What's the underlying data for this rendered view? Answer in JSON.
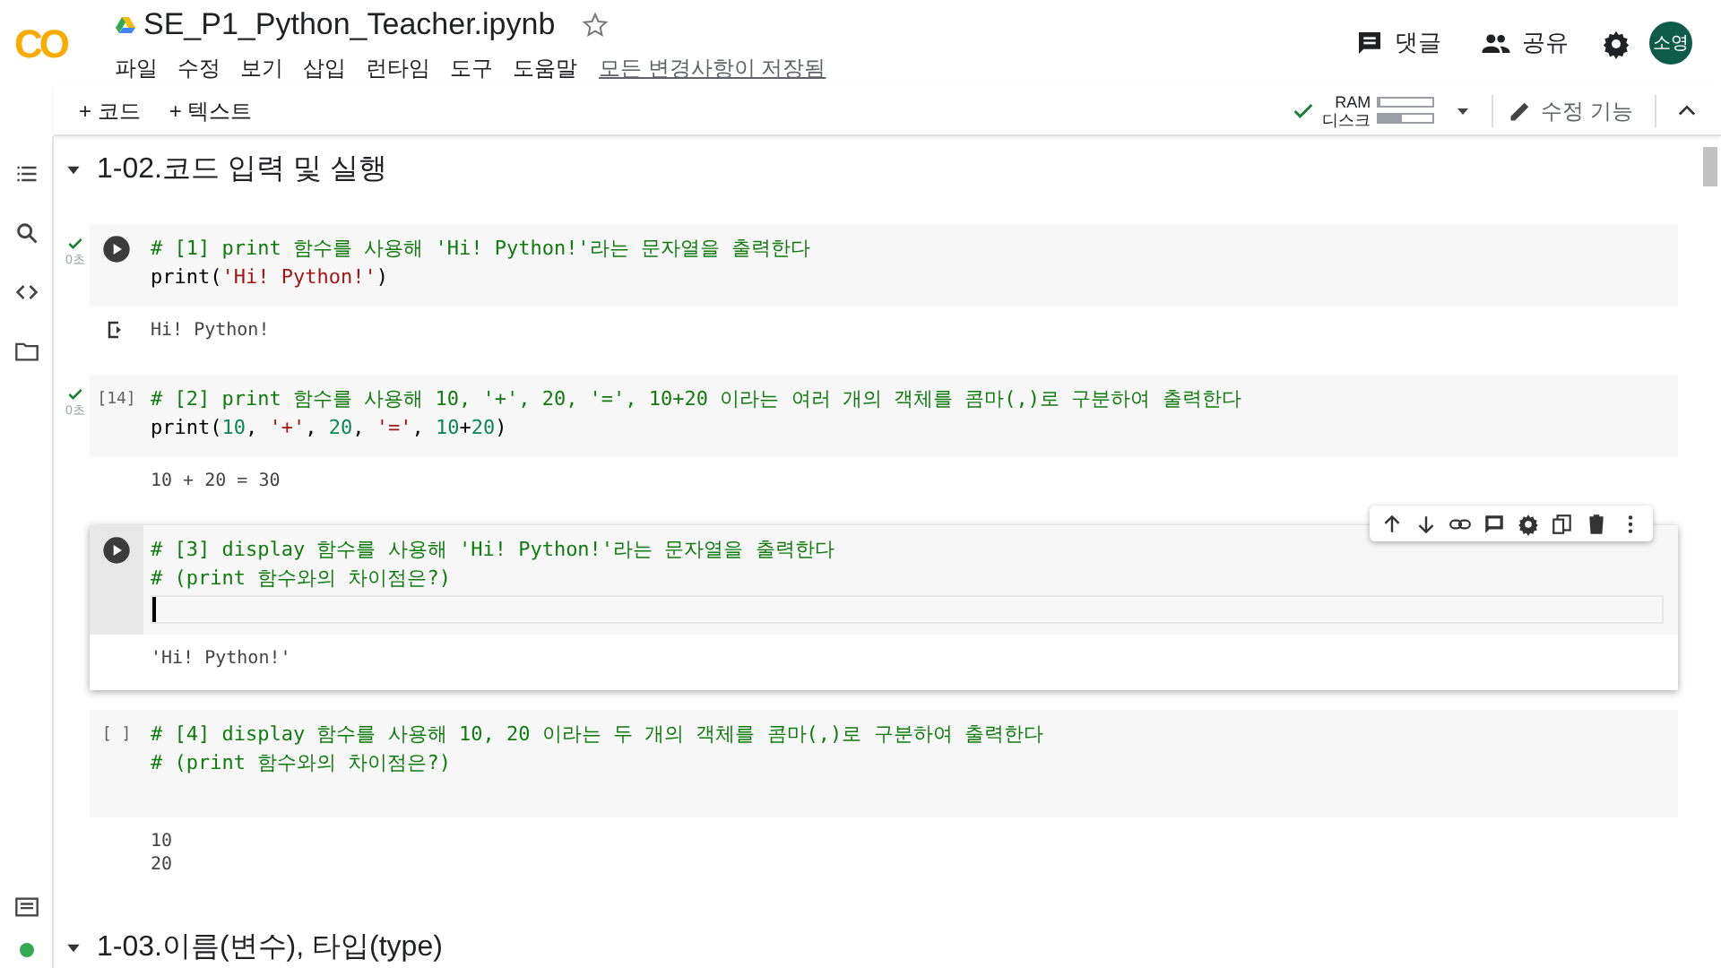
{
  "app": {
    "logo": "CO",
    "title": "SE_P1_Python_Teacher.ipynb",
    "starred": false,
    "menu": [
      "파일",
      "수정",
      "보기",
      "삽입",
      "런타임",
      "도구",
      "도움말"
    ],
    "save_status": "모든 변경사항이 저장됨",
    "comment_button": "댓글",
    "share_button": "공유",
    "avatar": "소영"
  },
  "toolbar": {
    "add_code": "+ 코드",
    "add_text": "+ 텍스트",
    "connected": true,
    "ram": {
      "label": "RAM",
      "level": 0.05
    },
    "disk": {
      "label": "디스크",
      "level": 0.45
    },
    "edit_mode": "수정 기능"
  },
  "sections": [
    {
      "title": "1-02.코드 입력 및 실행",
      "expanded": true,
      "cells": [
        {
          "kind": "run_button",
          "done": true,
          "run_time": "0초",
          "focused": false,
          "lines": [
            [
              {
                "kind": "comment",
                "text": "# [1] print 함수를 사용해 'Hi! Python!'라는 문자열을 출력한다"
              }
            ],
            [
              {
                "kind": "plain",
                "text": "print("
              },
              {
                "kind": "string",
                "text": "'Hi! Python!'"
              },
              {
                "kind": "plain",
                "text": ")"
              }
            ]
          ],
          "output": {
            "icon": true,
            "lines": [
              "Hi! Python!"
            ]
          }
        },
        {
          "kind": "count",
          "count": "[14]",
          "done": true,
          "run_time": "0초",
          "focused": false,
          "lines": [
            [
              {
                "kind": "comment",
                "text": "# [2] print 함수를 사용해 10, '+', 20, '=', 10+20 이라는 여러 개의 객체를 콤마(,)로 구분하여 출력한다"
              }
            ],
            [
              {
                "kind": "plain",
                "text": "print("
              },
              {
                "kind": "number",
                "text": "10"
              },
              {
                "kind": "plain",
                "text": ", "
              },
              {
                "kind": "string",
                "text": "'+'"
              },
              {
                "kind": "plain",
                "text": ", "
              },
              {
                "kind": "number",
                "text": "20"
              },
              {
                "kind": "plain",
                "text": ", "
              },
              {
                "kind": "string",
                "text": "'='"
              },
              {
                "kind": "plain",
                "text": ", "
              },
              {
                "kind": "number",
                "text": "10"
              },
              {
                "kind": "plain",
                "text": "+"
              },
              {
                "kind": "number",
                "text": "20"
              },
              {
                "kind": "plain",
                "text": ")"
              }
            ]
          ],
          "output": {
            "icon": false,
            "lines": [
              "10 + 20 = 30"
            ]
          }
        },
        {
          "kind": "run_button",
          "done": false,
          "focused": true,
          "lines": [
            [
              {
                "kind": "comment",
                "text": "# [3] display 함수를 사용해 'Hi! Python!'라는 문자열을 출력한다"
              }
            ],
            [
              {
                "kind": "comment",
                "text": "# (print 함수와의 차이점은?)"
              }
            ]
          ],
          "output": {
            "icon": false,
            "lines": [
              "'Hi! Python!'"
            ]
          }
        },
        {
          "kind": "count",
          "count": "[ ]",
          "done": false,
          "focused": false,
          "lines": [
            [
              {
                "kind": "comment",
                "text": "# [4] display 함수를 사용해 10, 20 이라는 두 개의 객체를 콤마(,)로 구분하여 출력한다"
              }
            ],
            [
              {
                "kind": "comment",
                "text": "# (print 함수와의 차이점은?)"
              }
            ]
          ],
          "output": {
            "icon": false,
            "lines": [
              "10",
              "20"
            ]
          }
        }
      ]
    },
    {
      "title": "1-03.이름(변수), 타입(type)",
      "expanded": true
    }
  ]
}
